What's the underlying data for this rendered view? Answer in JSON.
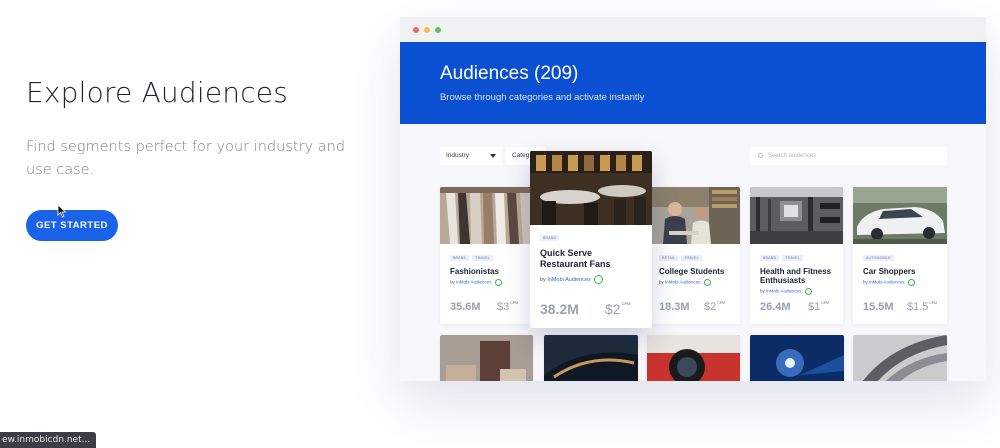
{
  "hero": {
    "title": "Explore Audiences",
    "subtitle": "Find segments perfect for your industry and use case.",
    "cta": "GET STARTED"
  },
  "status_bar": {
    "url": "ew.inmobicdn.net..."
  },
  "mockup": {
    "header": {
      "title": "Audiences (209)",
      "subtitle": "Browse through categories and activate instantly"
    },
    "filters": {
      "industry": "Industry",
      "category": "Categ",
      "search_placeholder": "Search audiences"
    },
    "cards": [
      {
        "name": "Fashionistas",
        "by_prefix": "by",
        "by": "InMobi Audiences",
        "tags": [
          "BRAND",
          "TRAVEL"
        ],
        "reach": "35.6M",
        "price": "$3",
        "cpm": "CPM"
      },
      {
        "name": "Quick Serve Restaurant Fans",
        "by_prefix": "by",
        "by": "InMobi Audiences",
        "tags": [
          "BRAND"
        ],
        "reach": "38.2M",
        "price": "$2",
        "cpm": "CPM"
      },
      {
        "name": "College Students",
        "by_prefix": "by",
        "by": "InMobi Audiences",
        "tags": [
          "RETAIL",
          "TRAVEL"
        ],
        "reach": "18.3M",
        "price": "$2",
        "cpm": "CPM"
      },
      {
        "name": "Health and Fitness Enthusiasts",
        "by_prefix": "by",
        "by": "InMobi Audiences",
        "tags": [
          "BRAND",
          "TRAVEL"
        ],
        "reach": "26.4M",
        "price": "$1",
        "cpm": "CPM"
      },
      {
        "name": "Car Shoppers",
        "by_prefix": "by",
        "by": "InMobi Audiences",
        "tags": [
          "AUTOMOBILE"
        ],
        "reach": "15.5M",
        "price": "$1.5",
        "cpm": "CPM"
      }
    ],
    "colors": {
      "accent": "#0b50d3",
      "button": "#1a63e8",
      "verified": "#3bb54a"
    }
  }
}
